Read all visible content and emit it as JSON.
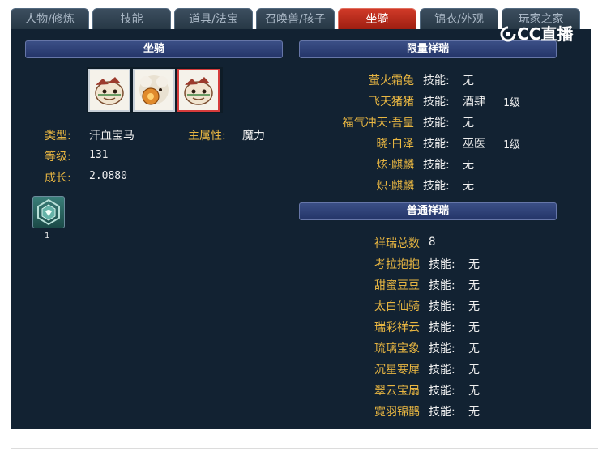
{
  "tabs": [
    {
      "label": "人物/修炼"
    },
    {
      "label": "技能"
    },
    {
      "label": "道具/法宝"
    },
    {
      "label": "召唤兽/孩子"
    },
    {
      "label": "坐骑"
    },
    {
      "label": "锦衣/外观"
    },
    {
      "label": "玩家之家"
    }
  ],
  "active_tab": "坐骑",
  "logo_text": "CC直播",
  "left": {
    "header": "坐骑",
    "mount_type_label": "类型:",
    "mount_type": "汗血宝马",
    "main_attr_label": "主属性:",
    "main_attr": "魔力",
    "level_label": "等级:",
    "level": "131",
    "growth_label": "成长:",
    "growth": "2.0880",
    "item_count": "1"
  },
  "limited": {
    "header": "限量祥瑞",
    "skill_label": "技能:",
    "items": [
      {
        "name": "萤火霜兔",
        "skill": "无",
        "level": ""
      },
      {
        "name": "飞天猪猪",
        "skill": "酒肆",
        "level": "1级"
      },
      {
        "name": "福气冲天·吾皇",
        "skill": "无",
        "level": ""
      },
      {
        "name": "晓·白泽",
        "skill": "巫医",
        "level": "1级"
      },
      {
        "name": "炫·麒麟",
        "skill": "无",
        "level": ""
      },
      {
        "name": "炽·麒麟",
        "skill": "无",
        "level": ""
      }
    ]
  },
  "normal": {
    "header": "普通祥瑞",
    "total_label": "祥瑞总数",
    "total": "8",
    "skill_label": "技能:",
    "items": [
      {
        "name": "考拉抱抱",
        "skill": "无"
      },
      {
        "name": "甜蜜豆豆",
        "skill": "无"
      },
      {
        "name": "太白仙骑",
        "skill": "无"
      },
      {
        "name": "瑞彩祥云",
        "skill": "无"
      },
      {
        "name": "琉璃宝象",
        "skill": "无"
      },
      {
        "name": "沉星寒犀",
        "skill": "无"
      },
      {
        "name": "翠云宝扇",
        "skill": "无"
      },
      {
        "name": "霓羽锦鹊",
        "skill": "无"
      }
    ]
  }
}
